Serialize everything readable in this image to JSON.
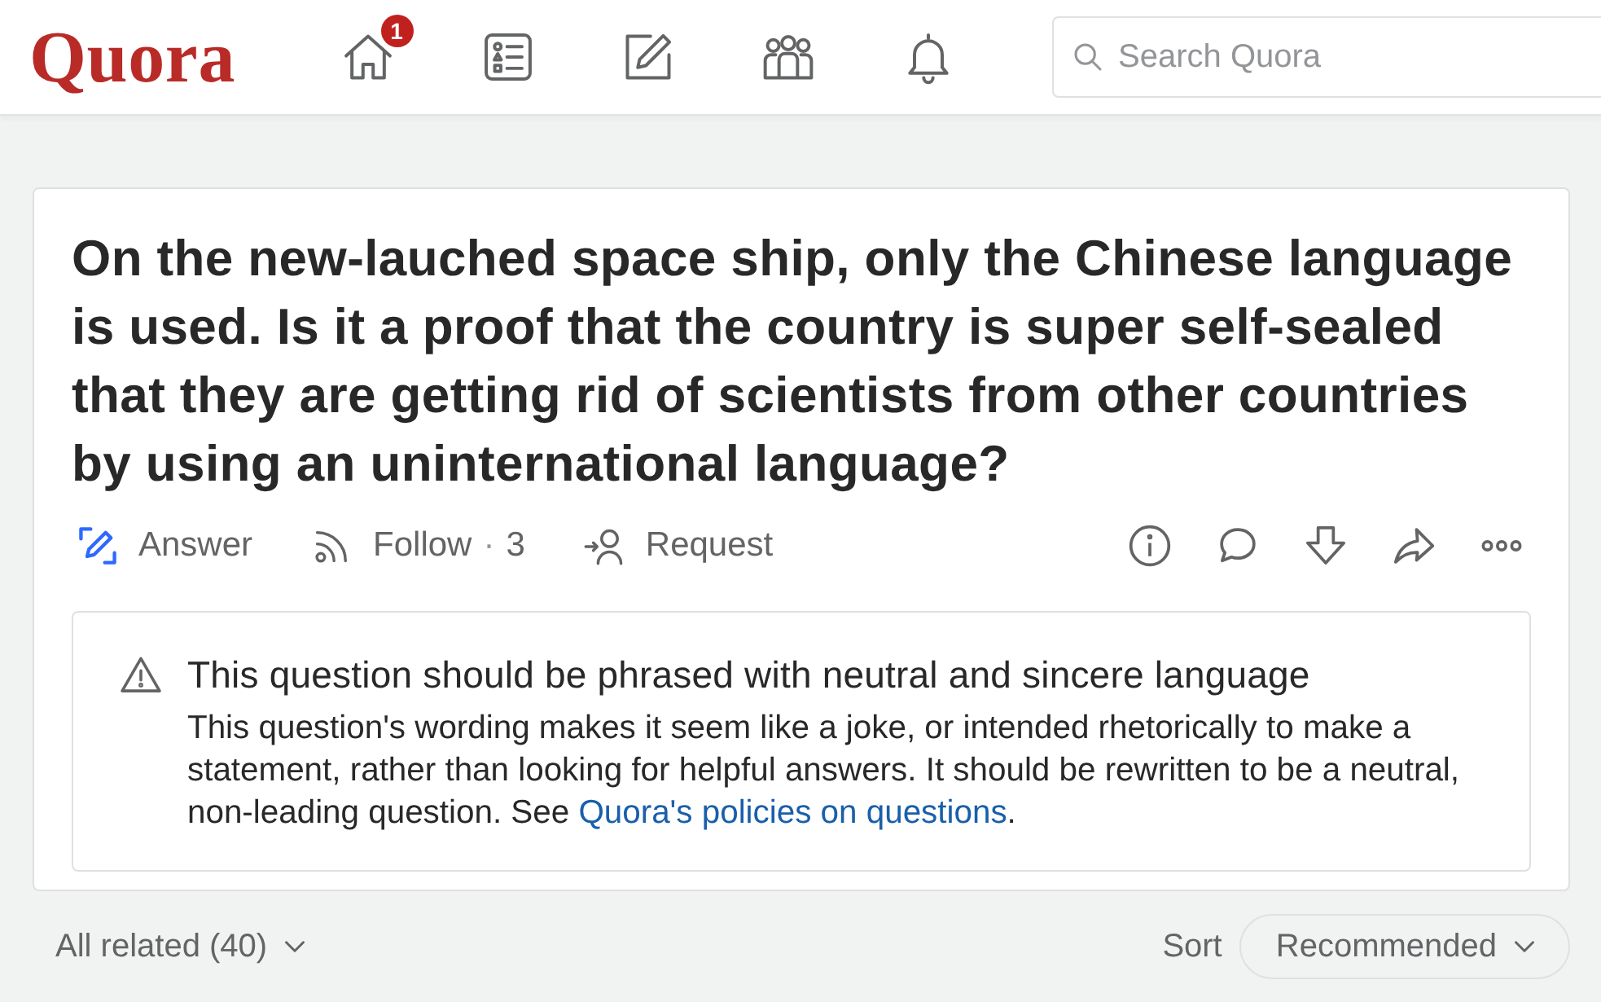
{
  "header": {
    "logo": "Quora",
    "nav": [
      {
        "kind": "home",
        "badge": "1"
      },
      {
        "kind": "answer-list"
      },
      {
        "kind": "write"
      },
      {
        "kind": "spaces"
      },
      {
        "kind": "notifications"
      }
    ],
    "search": {
      "placeholder": "Search Quora"
    }
  },
  "question": {
    "title": "On the new-lauched space ship, only the Chinese language is used. Is it a proof that the country is super self-sealed that they are getting rid of scientists from other countries by using an uninternational language?",
    "actions": [
      {
        "kind": "answer",
        "label": "Answer"
      },
      {
        "kind": "follow",
        "label": "Follow",
        "separator": "·",
        "count": "3"
      },
      {
        "kind": "request",
        "label": "Request"
      }
    ],
    "tools": [
      {
        "kind": "info"
      },
      {
        "kind": "comment"
      },
      {
        "kind": "downvote"
      },
      {
        "kind": "share"
      },
      {
        "kind": "more"
      }
    ],
    "notice": {
      "title": "This question should be phrased with neutral and sincere language",
      "text": "This question's wording makes it seem like a joke, or intended rhetorically to make a statement, rather than looking for helpful answers. It should be rewritten to be a neutral, non-leading question. See ",
      "link": "Quora's policies on questions",
      "text_end": "."
    }
  },
  "related": {
    "filter": "All related (40)",
    "sort_label": "Sort",
    "sort_value": "Recommended"
  }
}
